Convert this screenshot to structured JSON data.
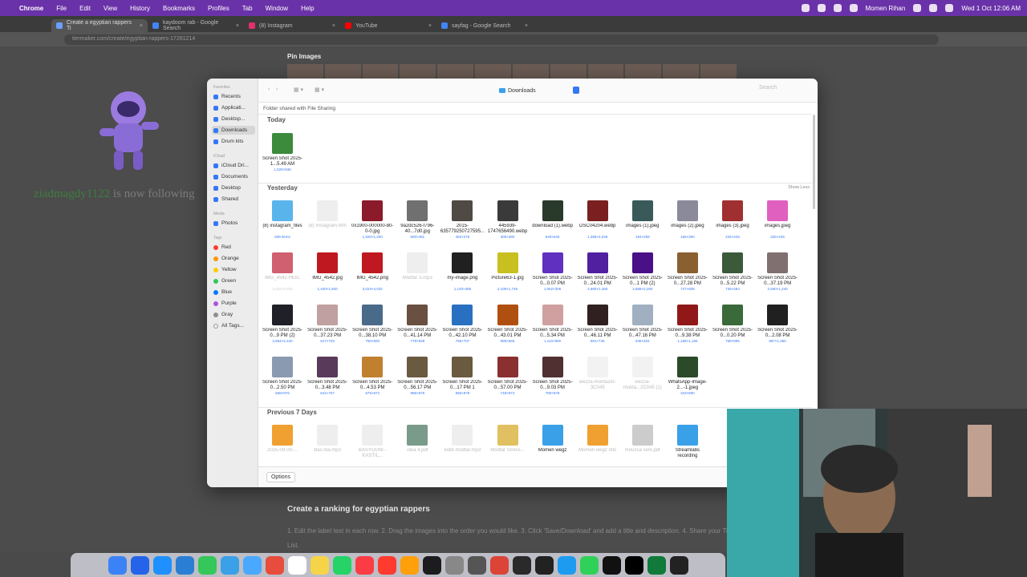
{
  "menubar": {
    "app": "Chrome",
    "items": [
      "File",
      "Edit",
      "View",
      "History",
      "Bookmarks",
      "Profiles",
      "Tab",
      "Window",
      "Help"
    ],
    "user": "Momen Rihan",
    "datetime": "Wed 1 Oct  12:06 AM"
  },
  "browser": {
    "tabs": [
      {
        "label": "Create a egyptian rappers Ti",
        "active": true,
        "color": "#6aa0ff"
      },
      {
        "label": "kaydoom rab - Google Search",
        "active": false,
        "color": "#4285f4"
      },
      {
        "label": "(8) Instagram",
        "active": false,
        "color": "#e1306c"
      },
      {
        "label": "YouTube",
        "active": false,
        "color": "#ff0000"
      },
      {
        "label": "sayfag - Google Search",
        "active": false,
        "color": "#4285f4"
      }
    ],
    "url": "tiermaker.com/create/egyptian-rappers-17261214"
  },
  "webpage": {
    "pin_images": "Pin Images",
    "follow_user": "ziadmagdy1122",
    "follow_text": " is now following",
    "ranking_title": "Create a ranking for egyptian rappers",
    "ranking_desc": "1. Edit the label text in each row. 2. Drag the images into the order you would like. 3. Click 'Save/Download' and add a title and description. 4. Share your Tier List."
  },
  "dialog": {
    "location": "Downloads",
    "search_placeholder": "Search",
    "shared_banner": "Folder shared with File Sharing",
    "sidebar": {
      "favorites_header": "Favorites",
      "favorites": [
        {
          "label": "Recents",
          "selected": false
        },
        {
          "label": "Applicati...",
          "selected": false
        },
        {
          "label": "Desktop...",
          "selected": false
        },
        {
          "label": "Downloads",
          "selected": true
        },
        {
          "label": "Drum kits",
          "selected": false
        }
      ],
      "icloud_header": "iCloud",
      "icloud": [
        "iCloud Dri...",
        "Documents",
        "Desktop",
        "Shared"
      ],
      "media_header": "Media",
      "media": [
        "Photos"
      ],
      "tags_header": "Tags",
      "tags": [
        {
          "label": "Red",
          "color": "#ff3b30"
        },
        {
          "label": "Orange",
          "color": "#ff9500"
        },
        {
          "label": "Yellow",
          "color": "#ffcc00"
        },
        {
          "label": "Green",
          "color": "#34c759"
        },
        {
          "label": "Blue",
          "color": "#007aff"
        },
        {
          "label": "Purple",
          "color": "#af52de"
        },
        {
          "label": "Gray",
          "color": "#8e8e93"
        },
        {
          "label": "All Tags...",
          "color": ""
        }
      ]
    },
    "groups": {
      "today": "Today",
      "yesterday": "Yesterday",
      "show_less": "Show Less",
      "prev7": "Previous 7 Days"
    },
    "today_files": [
      {
        "name": "Screen Shot 2025-1...5.49 AM",
        "meta": "1,020×936",
        "color": "#3c8a3c",
        "dim": false
      }
    ],
    "yesterday_files": [
      {
        "name": "(8) instagram_files",
        "meta": "509 items",
        "color": "#5ab4ec",
        "dim": false
      },
      {
        "name": "(8) Instagram.htm",
        "meta": "",
        "color": "#eeeeee",
        "dim": true
      },
      {
        "name": "0x1900-000000-80-0-0.jpg",
        "meta": "1,920×1,200",
        "color": "#8b1a2a",
        "dim": false
      },
      {
        "name": "9a2dc526-f796-40...7d0.jpg",
        "meta": "600×481",
        "color": "#707070",
        "dim": false
      },
      {
        "name": "2015-635779250727595...-758.jpg",
        "meta": "482×275",
        "color": "#504a44",
        "dim": false
      },
      {
        "name": "445939-1747656490.webp",
        "meta": "300×380",
        "color": "#3a3a3a",
        "dim": false
      },
      {
        "name": "download (1).webp",
        "meta": "640×640",
        "color": "#2a3a2a",
        "dim": false
      },
      {
        "name": "DSC04204.webp",
        "meta": "1,388×2,048",
        "color": "#7a2020",
        "dim": false
      },
      {
        "name": "images (1).jpeg",
        "meta": "194×259",
        "color": "#3a5a5a",
        "dim": false
      },
      {
        "name": "images (2).jpeg",
        "meta": "166×300",
        "color": "#8a8a9a",
        "dim": false
      },
      {
        "name": "images (3).jpeg",
        "meta": "225×225",
        "color": "#a03030",
        "dim": false
      },
      {
        "name": "images.jpeg",
        "meta": "225×225",
        "color": "#e060c0",
        "dim": false
      },
      {
        "name": "IMG_4542.HEIC",
        "meta": "3,024×4,032",
        "color": "#d06070",
        "dim": true
      },
      {
        "name": "IMG_4542.jpg",
        "meta": "1,440×1,920",
        "color": "#c01820",
        "dim": false
      },
      {
        "name": "IMG_4542.png",
        "meta": "3,024×4,032",
        "color": "#c01820",
        "dim": false
      },
      {
        "name": "Modtar 3.mp3",
        "meta": "",
        "color": "#eeeeee",
        "dim": true
      },
      {
        "name": "my-image.png",
        "meta": "1,140×385",
        "color": "#202020",
        "dim": false
      },
      {
        "name": "Picture63-1.jpg",
        "meta": "2,109×1,746",
        "color": "#c8c020",
        "dim": false
      },
      {
        "name": "Screen Shot 2025-0...0.07 PM",
        "meta": "1,062×306",
        "color": "#6030c0",
        "dim": false
      },
      {
        "name": "Screen Shot 2025-0...24.01 PM",
        "meta": "2,980×1,460",
        "color": "#5020a0",
        "dim": false
      },
      {
        "name": "Screen Shot 2025-0...1 PM (2)",
        "meta": "2,868×2,280",
        "color": "#4a1088",
        "dim": false
      },
      {
        "name": "Screen Shot 2025-0...27.28 PM",
        "meta": "727×838",
        "color": "#8a6030",
        "dim": false
      },
      {
        "name": "Screen Shot 2025-0...5.22 PM",
        "meta": "736×484",
        "color": "#3a5a3a",
        "dim": false
      },
      {
        "name": "Screen Shot 2025-0...37.19 PM",
        "meta": "2,560×1,440",
        "color": "#807070",
        "dim": false
      },
      {
        "name": "Screen Shot 2025-0...9 PM (2)",
        "meta": "3,584×2,240",
        "color": "#202028",
        "dim": false
      },
      {
        "name": "Screen Shot 2025-0...37.23 PM",
        "meta": "617×703",
        "color": "#c0a0a0",
        "dim": false
      },
      {
        "name": "Screen Shot 2025-0...38.10 PM",
        "meta": "750×600",
        "color": "#4a6a8a",
        "dim": false
      },
      {
        "name": "Screen Shot 2025-0...41.14 PM",
        "meta": "778×938",
        "color": "#6a5040",
        "dim": false
      },
      {
        "name": "Screen Shot 2025-0...42.10 PM",
        "meta": "756×707",
        "color": "#2a70c0",
        "dim": false
      },
      {
        "name": "Screen Shot 2025-0...43.01 PM",
        "meta": "998×665",
        "color": "#b05010",
        "dim": false
      },
      {
        "name": "Screen Shot 2025-0...5.34 PM",
        "meta": "1,110×900",
        "color": "#d0a0a0",
        "dim": false
      },
      {
        "name": "Screen Shot 2025-0...46.11 PM",
        "meta": "681×745",
        "color": "#302020",
        "dim": false
      },
      {
        "name": "Screen Shot 2025-0...47.16 PM",
        "meta": "946×404",
        "color": "#a0b0c0",
        "dim": false
      },
      {
        "name": "Screen Shot 2025-0...9.38 PM",
        "meta": "1,168×1,155",
        "color": "#901818",
        "dim": false
      },
      {
        "name": "Screen Shot 2025-0...0.20 PM",
        "meta": "768×895",
        "color": "#3a6a3a",
        "dim": false
      },
      {
        "name": "Screen Shot 2025-0...2.08 PM",
        "meta": "897×1,050",
        "color": "#202020",
        "dim": false
      },
      {
        "name": "Screen Shot 2025-0...2.50 PM",
        "meta": "668×976",
        "color": "#8a9ab0",
        "dim": false
      },
      {
        "name": "Screen Shot 2025-0...3.48 PM",
        "meta": "641×767",
        "color": "#5a3a5a",
        "dim": false
      },
      {
        "name": "Screen Shot 2025-0...4.53 PM",
        "meta": "875×872",
        "color": "#c08030",
        "dim": false
      },
      {
        "name": "Screen Shot 2025-0...56.17 PM",
        "meta": "985×878",
        "color": "#6a5a40",
        "dim": false
      },
      {
        "name": "Screen Shot 2025-0...17 PM 1",
        "meta": "985×878",
        "color": "#6a5a40",
        "dim": false
      },
      {
        "name": "Screen Shot 2025-0...57.00 PM",
        "meta": "748×872",
        "color": "#8a3030",
        "dim": false
      },
      {
        "name": "Screen Shot 2025-0...9.03 PM",
        "meta": "780×878",
        "color": "#503030",
        "dim": false
      },
      {
        "name": "wezza-montazer-3C045",
        "meta": "",
        "color": "#f2f2f2",
        "dim": true
      },
      {
        "name": "wezza-mokta...2C045 (1)",
        "meta": "",
        "color": "#f2f2f2",
        "dim": true
      },
      {
        "name": "WhatsApp-Image-2...-1.jpeg",
        "meta": "343×600",
        "color": "#2a4a2a",
        "dim": false
      }
    ],
    "prev7_files": [
      {
        "name": "2025-09-09-...",
        "meta": "",
        "color": "#f0a030",
        "dim": true
      },
      {
        "name": "Bas Ala.mp3",
        "meta": "",
        "color": "#eeeeee",
        "dim": true
      },
      {
        "name": "BASYOUNI - KASTIL...",
        "meta": "",
        "color": "#eeeeee",
        "dim": true
      },
      {
        "name": "idea 4.pdf",
        "meta": "",
        "color": "#7a9a8a",
        "dim": true
      },
      {
        "name": "kiddi modtar.mp3",
        "meta": "",
        "color": "#eeeeee",
        "dim": true
      },
      {
        "name": "Modtar Stress...",
        "meta": "",
        "color": "#e0c060",
        "dim": true
      },
      {
        "name": "Momen wegz",
        "meta": "",
        "color": "#3aa0e8",
        "dim": false
      },
      {
        "name": "Momen wegz mts",
        "meta": "",
        "color": "#f0a030",
        "dim": true
      },
      {
        "name": "moussa sem.pdf",
        "meta": "",
        "color": "#cccccc",
        "dim": true
      },
      {
        "name": "Streamlabs recording",
        "meta": "",
        "color": "#3aa0e8",
        "dim": false
      }
    ],
    "options_label": "Options"
  },
  "dock": {
    "colors": [
      "#3b82f6",
      "#2563eb",
      "#1e90ff",
      "#2a7fd4",
      "#34c759",
      "#3aa0e8",
      "#4aa8ff",
      "#e74c3c",
      "#ffffff",
      "#f5d547",
      "#25d366",
      "#fc3c44",
      "#ff3b30",
      "#ff9f0a",
      "#1c1c1e",
      "#888888",
      "#555555",
      "#db4437",
      "#2a2a2a",
      "#222222",
      "#1d9bf0",
      "#30d158",
      "#111111",
      "#000000",
      "#0f7a3a",
      "#222222"
    ]
  }
}
